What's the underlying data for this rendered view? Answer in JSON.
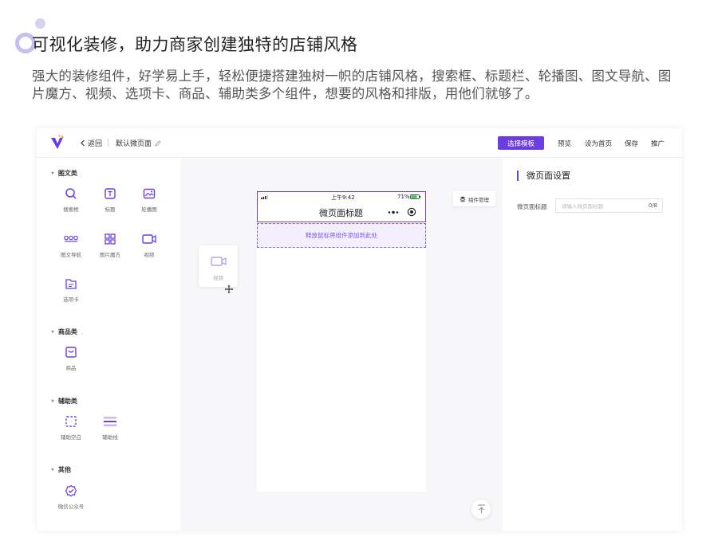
{
  "headline": "可视化装修，助力商家创建独特的店铺风格",
  "subtext": "强大的装修组件，好学易上手，轻松便捷搭建独树一帜的店铺风格，搜索框、标题栏、轮播图、图文导航、图片魔方、视频、选项卡、商品、辅助类多个组件，想要的风格和排版，用他们就够了。",
  "topbar": {
    "back_label": "返回",
    "page_name": "默认微页面",
    "primary_button": "选择模板",
    "nav": [
      "预览",
      "设为首页",
      "保存",
      "推广"
    ]
  },
  "categories": [
    {
      "title": "图文类",
      "items": [
        {
          "label": "搜索框",
          "icon": "search-icon"
        },
        {
          "label": "标题",
          "icon": "title-icon"
        },
        {
          "label": "轮播图",
          "icon": "image-carousel-icon"
        },
        {
          "label": "图文导航",
          "icon": "nav-dots-icon"
        },
        {
          "label": "图片魔方",
          "icon": "grid-icon"
        },
        {
          "label": "视频",
          "icon": "video-icon"
        },
        {
          "label": "选项卡",
          "icon": "tab-icon"
        }
      ]
    },
    {
      "title": "商品类",
      "items": [
        {
          "label": "商品",
          "icon": "shop-bag-icon"
        }
      ]
    },
    {
      "title": "辅助类",
      "items": [
        {
          "label": "辅助空白",
          "icon": "blank-icon"
        },
        {
          "label": "辅助线",
          "icon": "divider-icon"
        }
      ]
    },
    {
      "title": "其他",
      "items": [
        {
          "label": "微信公众号",
          "icon": "badge-check-icon"
        }
      ]
    }
  ],
  "drag_card": {
    "label": "视频"
  },
  "phone": {
    "time": "上午9:42",
    "battery": "71%",
    "title": "微页面标题",
    "dropzone_text": "释放鼠标将组件添加到此处"
  },
  "layer_button": "组件管理",
  "right_panel": {
    "title": "微页面设置",
    "field_label": "微页面标题",
    "field_placeholder": "请输入微页面标题",
    "field_count": "0/8"
  },
  "colors": {
    "accent": "#6b3de0",
    "accent_light": "#f3effd"
  }
}
